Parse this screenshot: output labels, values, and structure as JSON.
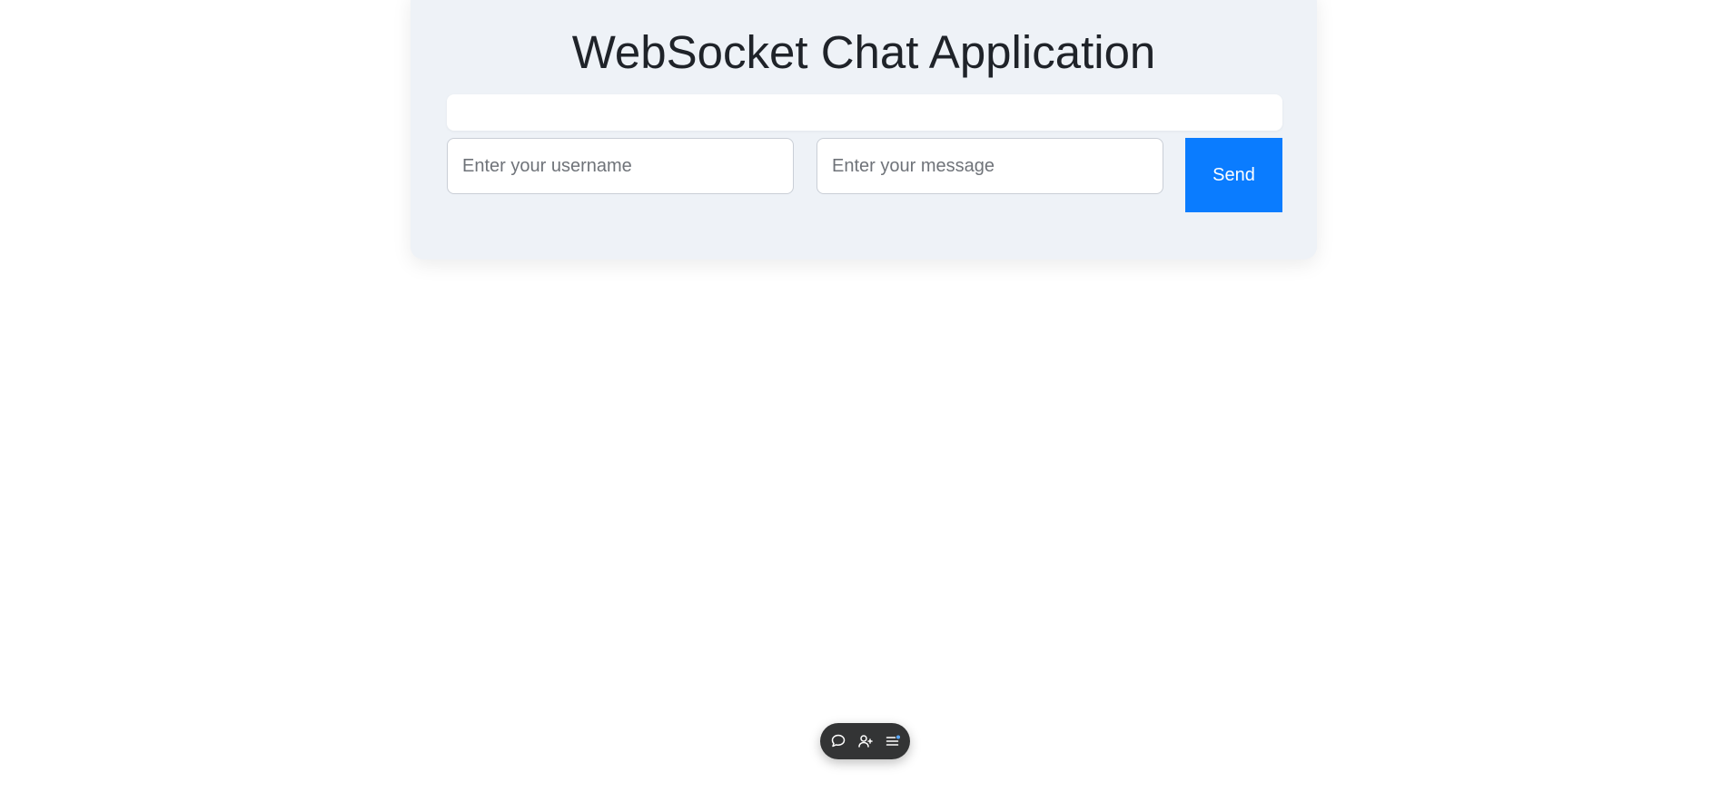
{
  "app": {
    "title": "WebSocket Chat Application"
  },
  "chat": {
    "messages": []
  },
  "form": {
    "username_placeholder": "Enter your username",
    "username_value": "",
    "message_placeholder": "Enter your message",
    "message_value": "",
    "send_label": "Send"
  },
  "toolbar": {
    "buttons": [
      {
        "icon": "chat-bubble-icon"
      },
      {
        "icon": "add-user-icon"
      },
      {
        "icon": "menu-list-icon"
      }
    ]
  },
  "colors": {
    "card_background": "#eef2f7",
    "send_button": "#0a7cff",
    "toolbar_background": "#333435",
    "toolbar_accent": "#5aa9ff"
  }
}
